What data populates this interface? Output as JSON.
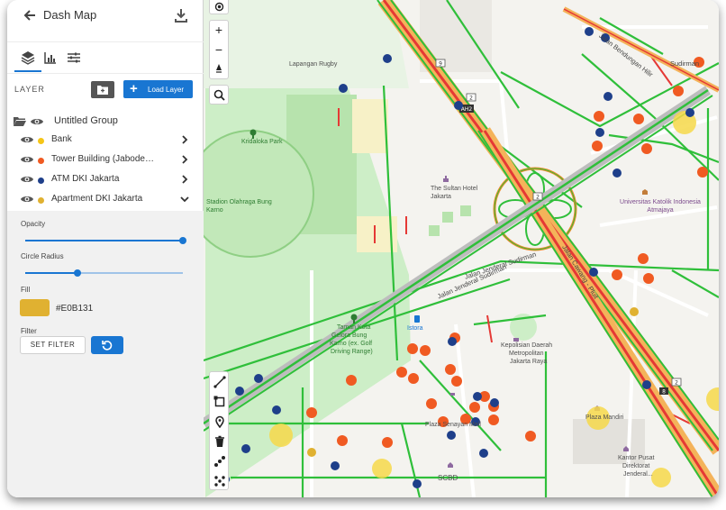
{
  "header": {
    "title": "Dash Map"
  },
  "icons": {
    "back": "arrow-left-icon",
    "download": "download-icon",
    "layers": "layers-icon",
    "chart": "bar-chart-icon",
    "settings": "sliders-icon"
  },
  "layer_section": {
    "label": "LAYER",
    "load_button": "Load Layer"
  },
  "group": {
    "name": "Untitled Group"
  },
  "layers": [
    {
      "name": "Bank",
      "color": "#F5C518",
      "expanded": false
    },
    {
      "name": "Tower Building (Jabode…",
      "color": "#F05A22",
      "expanded": false
    },
    {
      "name": "ATM DKI Jakarta",
      "color": "#1E3F8A",
      "expanded": false
    },
    {
      "name": "Apartment DKI Jakarta",
      "color": "#E0B131",
      "expanded": true
    }
  ],
  "settings": {
    "opacity_label": "Opacity",
    "opacity_value": 1.0,
    "radius_label": "Circle Radius",
    "radius_value": 0.33,
    "fill_label": "Fill",
    "fill_color": "#E0B131",
    "fill_text": "#E0B131",
    "filter_label": "Filter",
    "set_filter_button": "SET FILTER"
  },
  "map": {
    "labels": {
      "lapangan_rugby": "Lapangan Rugby",
      "kridaloka": "Kridaloka Park",
      "stadium": "Stadion Olahraga Bung Karno",
      "sultan": "The Sultan Hotel Jakarta",
      "atma": "Universitas Katolik Indonesia Atmajaya",
      "taman_kota_1": "Taman Kota",
      "taman_kota_2": "Gelora Bung",
      "taman_kota_3": "Karno (ex. Golf",
      "taman_kota_4": "Driving Range)",
      "istora": "Istora",
      "polda_1": "Kepolisian Daerah",
      "polda_2": "Metropolitan",
      "polda_3": "Jakarta Raya",
      "senayan_mall": "Plaza Senayan Mall",
      "scbd": "SCBD",
      "plaza_mandiri": "Plaza Mandiri",
      "kantor_pusat_1": "Kantor Pusat",
      "kantor_pusat_2": "Direktorat",
      "kantor_pusat_3": "Jenderal...",
      "road_sudirman_1": "Jalan Jenderal Sudirman",
      "road_sudirman_2": "Jalan Jenderal Sudirman",
      "road_cawang": "Jalan Cawang - Pluit",
      "road_bendungan": "Jalan Bendungan Hilir",
      "road_sudirman_top": "Sudirman"
    }
  }
}
